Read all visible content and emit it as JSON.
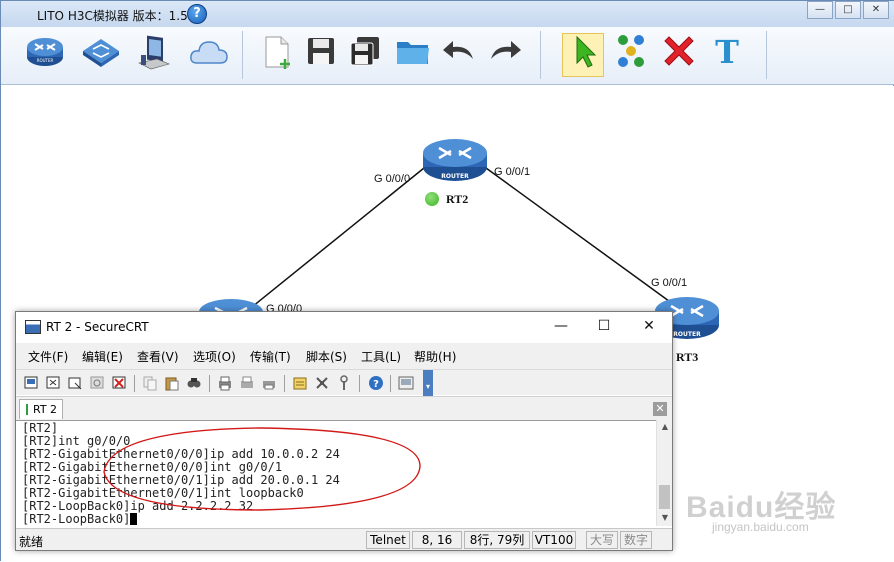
{
  "app": {
    "title": "LITO H3C模拟器 版本：1.5.2",
    "help_glyph": "?",
    "window_buttons": [
      "—",
      "□",
      "✕"
    ]
  },
  "toolbar": {
    "items": [
      "router-icon",
      "switch-icon",
      "pc-icon",
      "cloud-icon",
      "new-file-icon",
      "save-icon",
      "save-as-icon",
      "open-folder-icon",
      "undo-icon",
      "redo-icon",
      "select-pointer-icon",
      "connect-icon",
      "delete-icon",
      "text-icon"
    ]
  },
  "topology": {
    "rt2": {
      "name": "RT2",
      "port_left": "G 0/0/0",
      "port_right": "G 0/0/1",
      "status_color": "#3cb521"
    },
    "rt3": {
      "name": "RT3",
      "port": "G 0/0/1"
    },
    "rt1": {
      "port": "G 0/0/0"
    }
  },
  "crt": {
    "title": "RT 2 - SecureCRT",
    "controls": [
      "—",
      "☐",
      "✕"
    ],
    "menu": [
      "文件(F)",
      "编辑(E)",
      "查看(V)",
      "选项(O)",
      "传输(T)",
      "脚本(S)",
      "工具(L)",
      "帮助(H)"
    ],
    "tab_label": "RT 2",
    "tab_close": "✕",
    "terminal": [
      "[RT2]",
      "[RT2]int g0/0/0",
      "[RT2-GigabitEthernet0/0/0]ip add 10.0.0.2 24",
      "[RT2-GigabitEthernet0/0/0]int g0/0/1",
      "[RT2-GigabitEthernet0/0/1]ip add 20.0.0.1 24",
      "[RT2-GigabitEthernet0/0/1]int loopback0",
      "[RT2-LoopBack0]ip add 2.2.2.2 32",
      "[RT2-LoopBack0]"
    ],
    "status": {
      "ready": "就绪",
      "protocol": "Telnet",
      "position": "8,  16",
      "rows_cols": "8行, 79列",
      "terminal_type": "VT100",
      "caps": "大写",
      "num": "数字"
    }
  },
  "watermark": {
    "main": "Baidu经验",
    "sub": "jingyan.baidu.com"
  }
}
